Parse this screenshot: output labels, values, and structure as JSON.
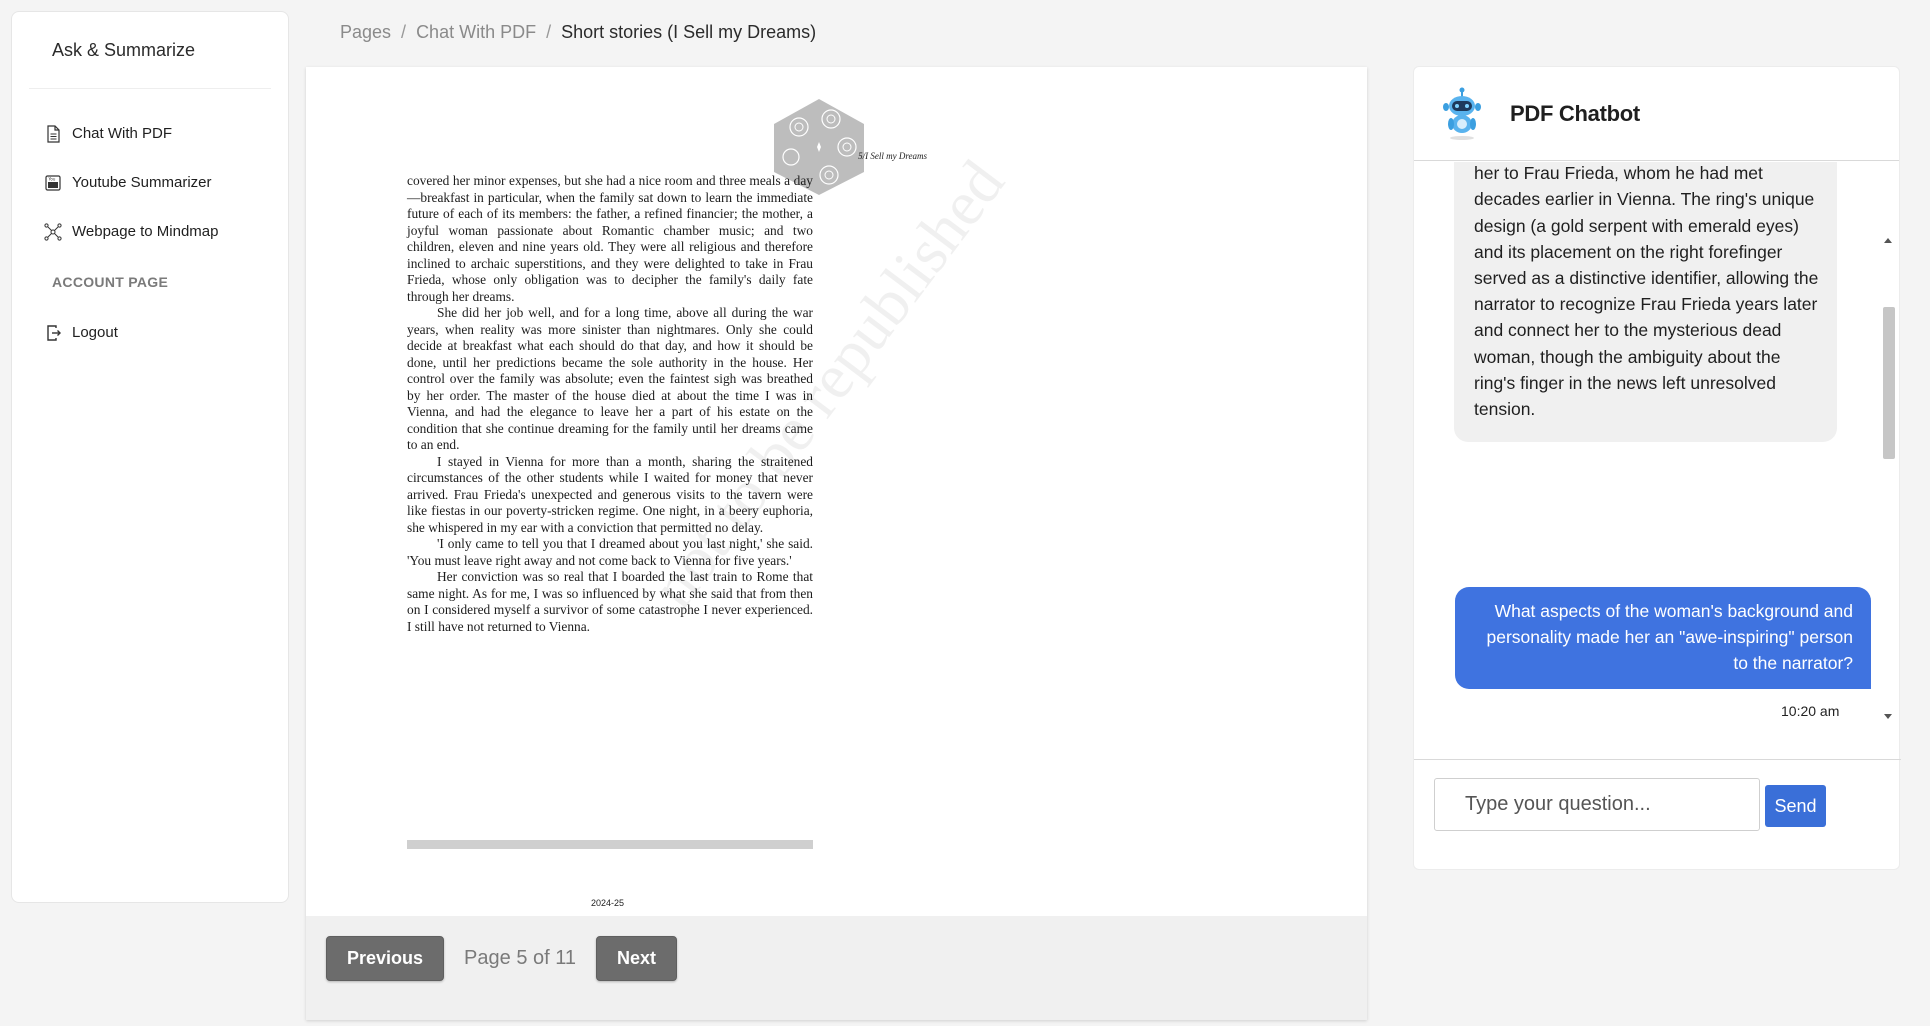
{
  "sidebar": {
    "brand": "Ask & Summarize",
    "items": [
      {
        "label": "Chat With PDF",
        "icon": "document-icon"
      },
      {
        "label": "Youtube Summarizer",
        "icon": "youtube-icon"
      },
      {
        "label": "Webpage to Mindmap",
        "icon": "mindmap-icon"
      }
    ],
    "section": "ACCOUNT PAGE",
    "logout": {
      "label": "Logout",
      "icon": "logout-icon"
    }
  },
  "breadcrumb": {
    "items": [
      "Pages",
      "Chat With PDF"
    ],
    "current": "Short stories (I Sell my Dreams)"
  },
  "pdf": {
    "page_header": "5/I Sell my Dreams",
    "paragraphs": [
      "covered her minor expenses, but she had a nice room and three meals a day—breakfast in particular, when the family sat down to learn the immediate future of each of its members: the father, a refined financier; the mother, a joyful woman passionate about Romantic chamber music; and two children, eleven and nine years old. They were all religious and therefore inclined to archaic superstitions, and they were delighted to take in Frau Frieda, whose only obligation was to decipher the family's daily fate through her dreams.",
      "She did her job well, and for a long time, above all during the war years, when reality was more sinister than nightmares. Only she could decide at breakfast what each should do that day, and how it should be done, until her predictions became the sole authority in the house. Her control over the family was absolute; even the faintest sigh was breathed by her order. The master of the house died at about the time I was in Vienna, and had the elegance to leave her a part of his estate on the condition that she continue dreaming for the family until her dreams came to an end.",
      "I stayed in Vienna for more than a month, sharing the straitened circumstances of the other students while I waited for money that never arrived. Frau Frieda's unexpected and generous visits to the tavern were like fiestas in our poverty-stricken regime. One night, in a beery euphoria, she whispered in my ear with a conviction that permitted no delay.",
      "'I only came to tell you that I dreamed about you last night,' she said. 'You must leave right away and not come back to Vienna for five years.'",
      "Her conviction was so real that I boarded the last train to Rome that same night. As for me, I was so influenced by what she said that from then on I considered myself a survivor of some catastrophe I never experienced. I still have not returned to Vienna."
    ],
    "watermark": "not to be republished",
    "footer": "2024-25"
  },
  "pager": {
    "previous": "Previous",
    "indicator": "Page 5 of 11",
    "next": "Next"
  },
  "chat": {
    "title": "PDF Chatbot",
    "bot_message": "significant to the narrator because it linked her to Frau Frieda, whom he had met decades earlier in Vienna. The ring's unique design (a gold serpent with emerald eyes) and its placement on the right forefinger served as a distinctive identifier, allowing the narrator to recognize Frau Frieda years later and connect her to the mysterious dead woman, though the ambiguity about the ring's finger in the news left unresolved tension.",
    "user_message": "What aspects of the woman's background and personality made her an \"awe-inspiring\" person to the narrator?",
    "time": "10:20 am",
    "input_placeholder": "Type your question...",
    "send": "Send"
  },
  "colors": {
    "accent": "#3f73e0",
    "button_gray": "#6c6c6c"
  }
}
